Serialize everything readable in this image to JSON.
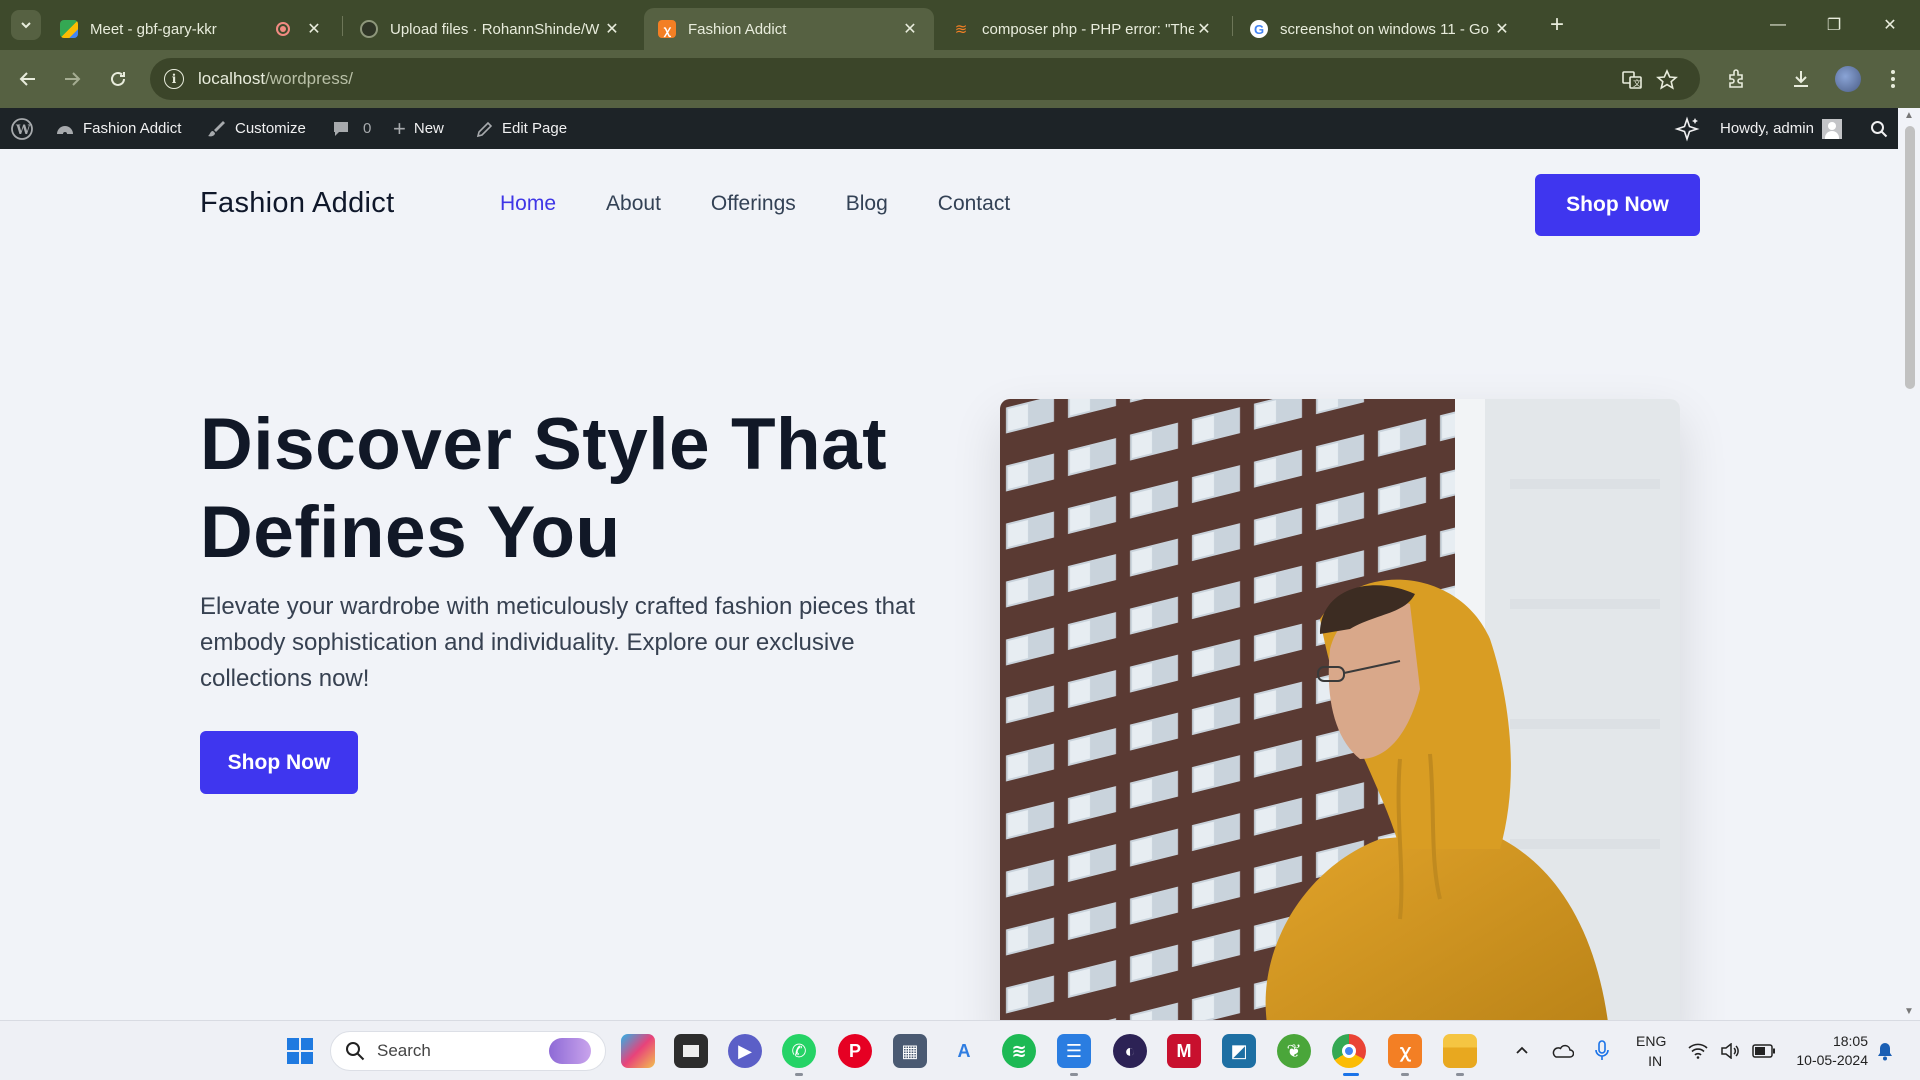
{
  "browser": {
    "tabs": [
      {
        "title": "Meet - gbf-gary-kkr",
        "favicon": "google-meet-icon",
        "recording": true
      },
      {
        "title": "Upload files · RohannShinde/W",
        "favicon": "github-icon"
      },
      {
        "title": "Fashion Addict",
        "favicon": "xampp-icon",
        "active": true
      },
      {
        "title": "composer php - PHP error: \"The",
        "favicon": "stackoverflow-icon"
      },
      {
        "title": "screenshot on windows 11 - Go",
        "favicon": "google-icon"
      }
    ],
    "url_host": "localhost",
    "url_path": "/wordpress/"
  },
  "wp_admin_bar": {
    "site_name": "Fashion Addict",
    "customize": "Customize",
    "comments_count": "0",
    "new_label": "New",
    "edit_page": "Edit Page",
    "howdy": "Howdy, admin"
  },
  "site": {
    "brand": "Fashion Addict",
    "nav": [
      "Home",
      "About",
      "Offerings",
      "Blog",
      "Contact"
    ],
    "header_cta": "Shop Now",
    "hero": {
      "title_line1": "Discover Style That",
      "title_line2": "Defines You",
      "subtitle": "Elevate your wardrobe with meticulously crafted fashion pieces that embody sophistication and individuality. Explore our exclusive collections now!",
      "cta": "Shop Now"
    },
    "accent_color": "#3f36ef"
  },
  "taskbar": {
    "search_placeholder": "Search",
    "lang_top": "ENG",
    "lang_bottom": "IN",
    "time": "18:05",
    "date": "10-05-2024"
  }
}
